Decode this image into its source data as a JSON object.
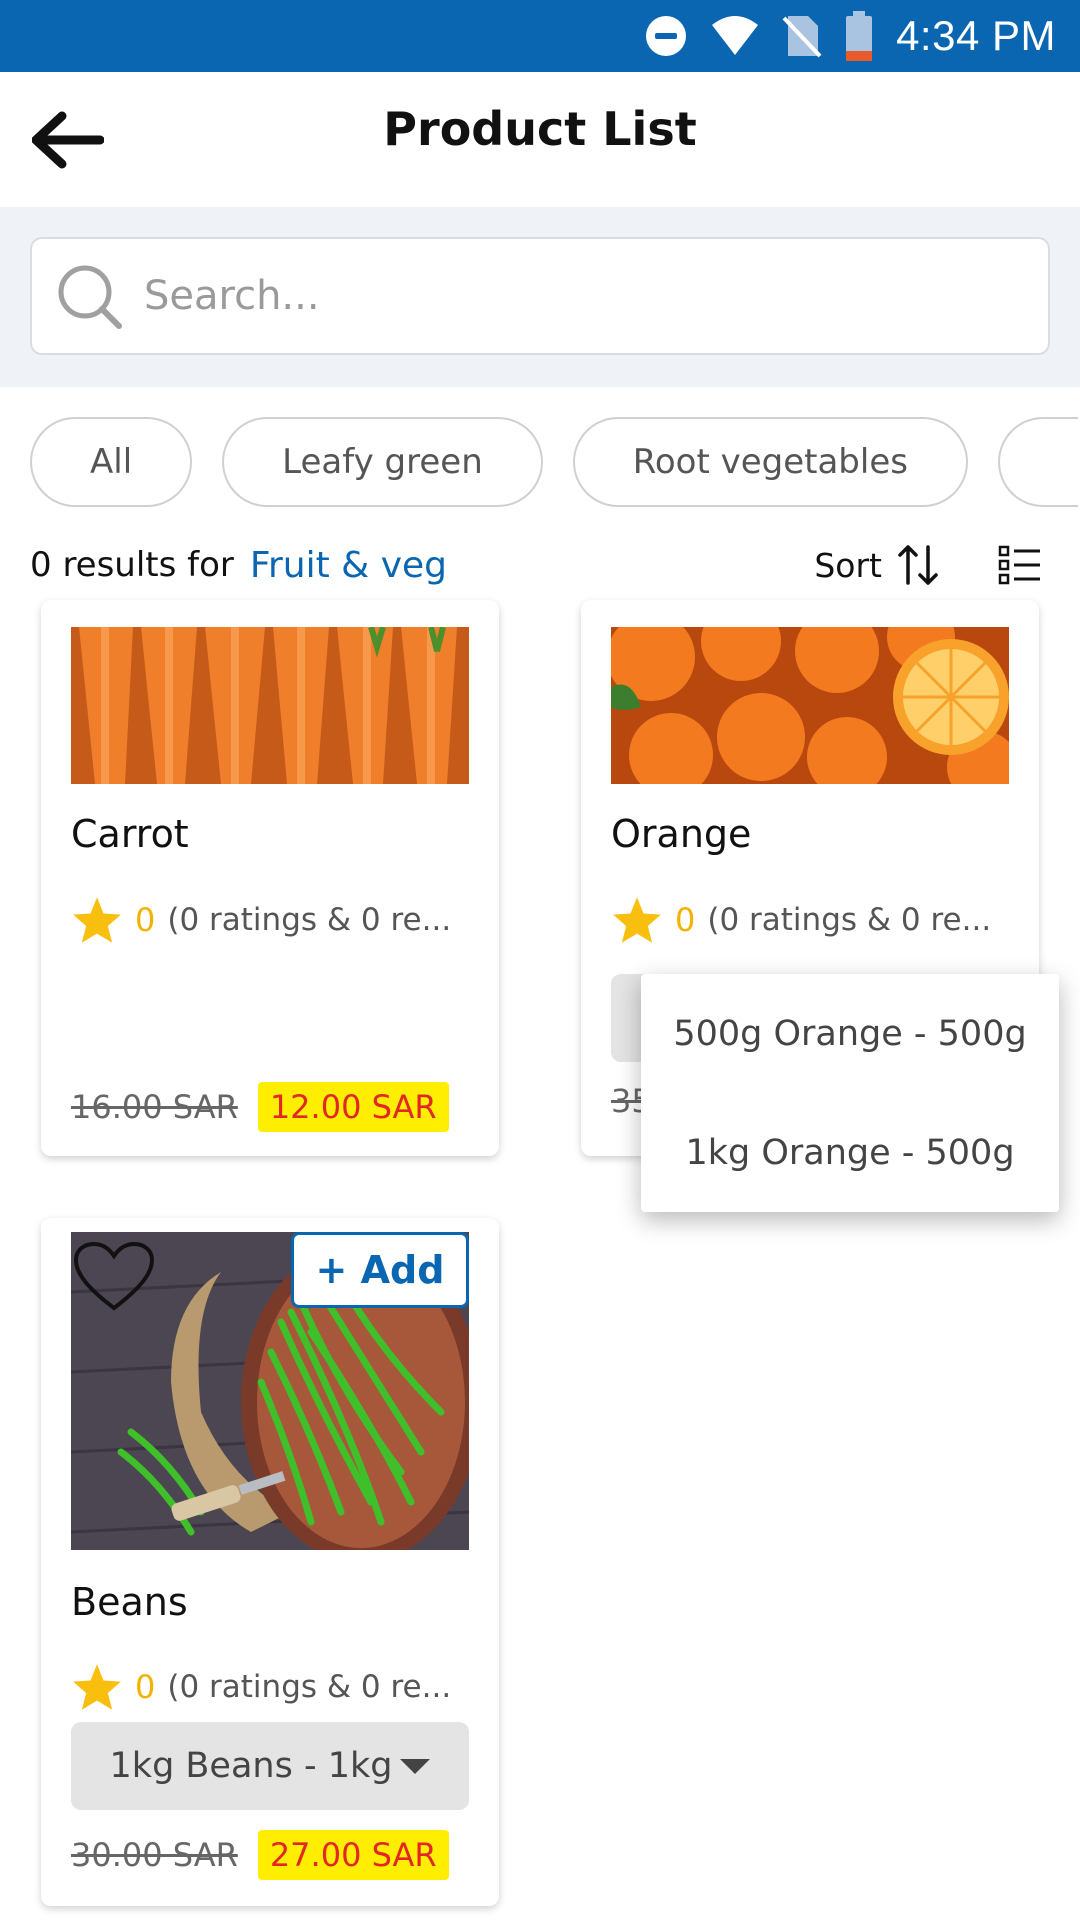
{
  "status_bar": {
    "time": "4:34 PM"
  },
  "header": {
    "title": "Product List"
  },
  "search": {
    "placeholder": "Search...",
    "value": ""
  },
  "filters": [
    "All",
    "Leafy green",
    "Root vegetables"
  ],
  "results": {
    "prefix": "0 results for",
    "category": "Fruit & veg"
  },
  "toolbar": {
    "sort_label": "Sort"
  },
  "products": [
    {
      "name": "Carrot",
      "rating": "0",
      "rating_text": "(0 ratings & 0 re...",
      "old_price": "16.00 SAR",
      "new_price": "12.00 SAR"
    },
    {
      "name": "Orange",
      "rating": "0",
      "rating_text": "(0 ratings & 0 re...",
      "old_price": "35",
      "new_price": ""
    },
    {
      "name": "Beans",
      "rating": "0",
      "rating_text": "(0 ratings & 0 re...",
      "variant": "1kg Beans - 1kg",
      "old_price": "30.00 SAR",
      "new_price": "27.00 SAR",
      "add_label": "+ Add"
    }
  ],
  "dropdown": {
    "options": [
      "500g Orange - 500g",
      "1kg Orange - 500g"
    ]
  },
  "colors": {
    "primary": "#0a66b1",
    "rating": "#f0b400",
    "price_highlight": "#ffee00",
    "price_text": "#e32626"
  }
}
